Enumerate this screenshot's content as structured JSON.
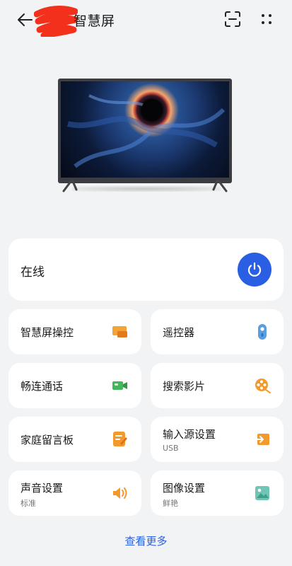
{
  "header": {
    "title": "智慧屏",
    "icons": [
      "back-arrow-icon",
      "scan-frame-icon",
      "more-dots-icon"
    ]
  },
  "status": {
    "text": "在线",
    "power_color": "#2a5fe3"
  },
  "tiles": [
    {
      "label": "智慧屏操控",
      "sub": "",
      "icon": "screen-control-icon"
    },
    {
      "label": "遥控器",
      "sub": "",
      "icon": "remote-icon"
    },
    {
      "label": "畅连通话",
      "sub": "",
      "icon": "video-call-icon"
    },
    {
      "label": "搜索影片",
      "sub": "",
      "icon": "film-reel-icon"
    },
    {
      "label": "家庭留言板",
      "sub": "",
      "icon": "message-board-icon"
    },
    {
      "label": "输入源设置",
      "sub": "USB",
      "icon": "input-source-icon"
    },
    {
      "label": "声音设置",
      "sub": "标准",
      "icon": "speaker-icon"
    },
    {
      "label": "图像设置",
      "sub": "鲜艳",
      "icon": "image-icon"
    }
  ],
  "footer": {
    "view_more": "查看更多"
  }
}
